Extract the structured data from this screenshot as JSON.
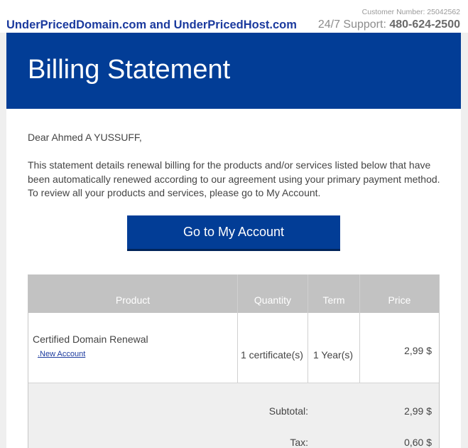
{
  "header": {
    "brand": "UnderPricedDomain.com and UnderPricedHost.com",
    "customer_number_label": "Customer Number: 25042562",
    "support_label": "24/7 Support:",
    "support_phone": "480-624-2500"
  },
  "banner": {
    "title": "Billing Statement"
  },
  "body": {
    "greeting": "Dear Ahmed A YUSSUFF,",
    "intro": "This statement details renewal billing for the products and/or services listed below that have been automatically renewed according to our agreement using your primary payment method. To review all your products and services, please go to My Account.",
    "cta_label": "Go to My Account"
  },
  "table": {
    "headers": {
      "product": "Product",
      "quantity": "Quantity",
      "term": "Term",
      "price": "Price"
    },
    "rows": [
      {
        "product": "Certified Domain Renewal",
        "link": ".New Account",
        "quantity": "1 certificate(s)",
        "term": "1 Year(s)",
        "price": "2,99 $"
      }
    ],
    "totals": {
      "subtotal_label": "Subtotal:",
      "subtotal_value": "2,99 $",
      "tax_label": "Tax:",
      "tax_value": "0,60 $"
    }
  },
  "colors": {
    "brand_blue": "#023d96",
    "link_blue": "#1b3a9e",
    "table_header_gray": "#c2c2c2"
  }
}
